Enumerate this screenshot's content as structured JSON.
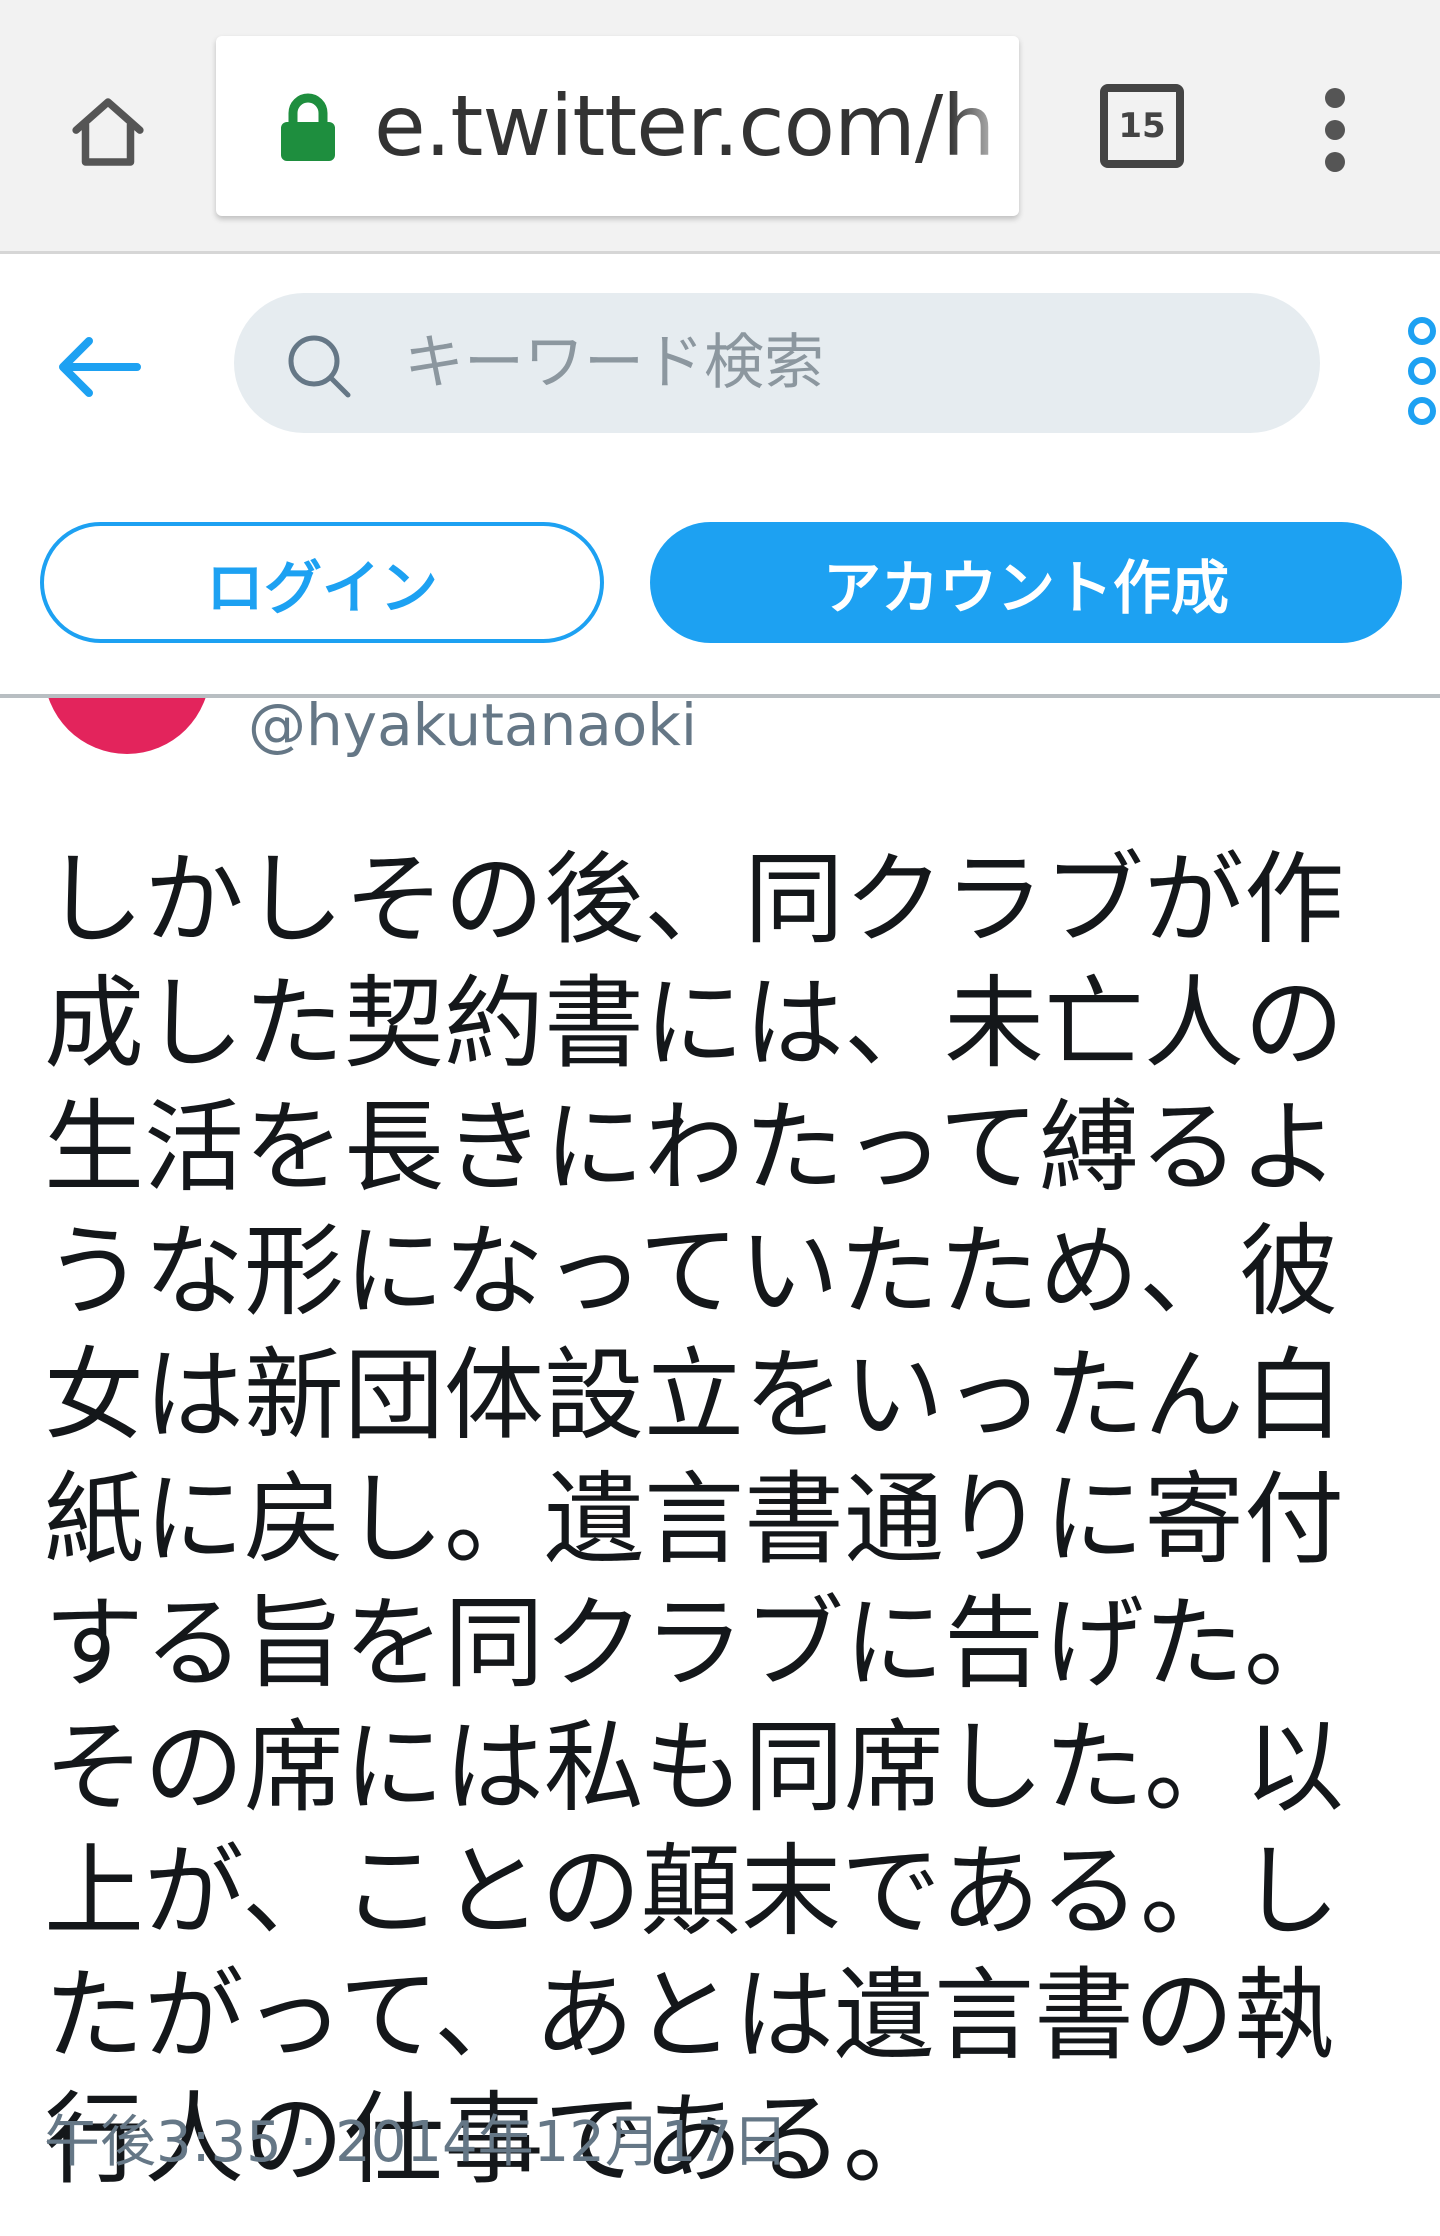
{
  "browser": {
    "home_icon": "home-icon",
    "lock_icon": "lock-icon",
    "url": "e.twitter.com/h",
    "tab_count": "15",
    "menu_icon": "vertical-dots-icon"
  },
  "header": {
    "back_icon": "arrow-left-icon",
    "search": {
      "placeholder": "キーワード検索",
      "icon": "search-icon"
    },
    "more_icon": "more-icon",
    "login_label": "ログイン",
    "signup_label": "アカウント作成"
  },
  "tweet": {
    "handle": "@hyakutanaoki",
    "text": "しかしその後、同クラブが作成した契約書には、未亡人の生活を長きにわたって縛るような形になっていたため、彼女は新団体設立をいったん白紙に戻し。遺言書通りに寄付する旨を同クラブに告げた。その席には私も同席した。以上が、ことの顛末である。したがって、あとは遺言書の執行人の仕事である。",
    "timestamp": "午後3:35 · 2014年12月17日"
  },
  "colors": {
    "accent": "#1da1f2",
    "avatar": "#e3245c",
    "secure": "#1e8e3e",
    "muted": "#657786"
  }
}
